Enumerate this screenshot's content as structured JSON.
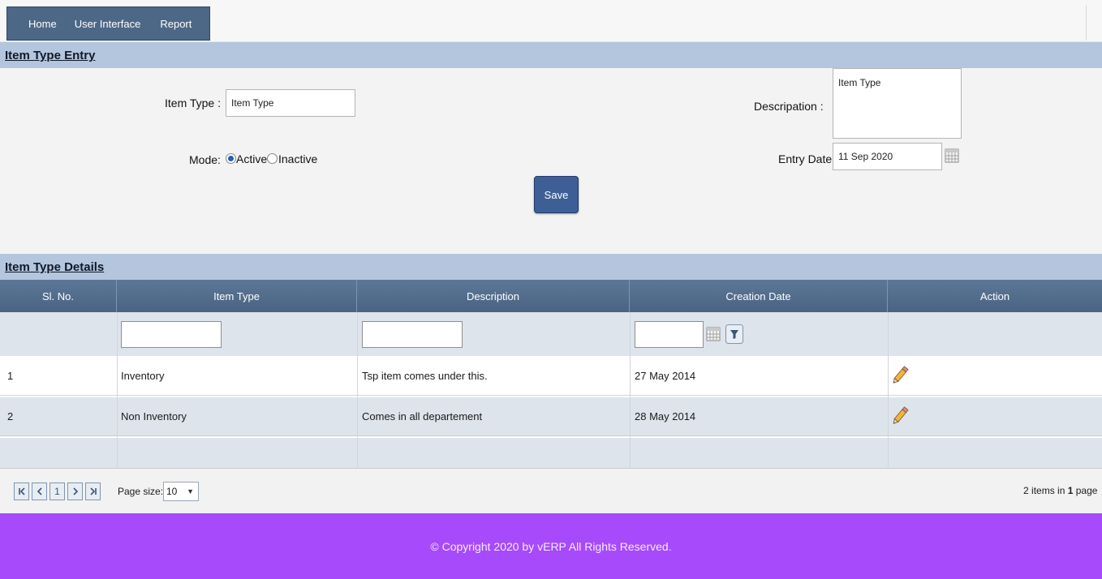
{
  "nav": {
    "items": [
      "Home",
      "User Interface",
      "Report"
    ]
  },
  "entry": {
    "title": "Item Type Entry",
    "item_type_label": "Item Type :",
    "item_type_value": "Item Type",
    "description_label": "Descripation :",
    "description_value": "Item Type",
    "mode_label": "Mode:",
    "mode_active": "Active",
    "mode_inactive": "Inactive",
    "mode_selected": "Active",
    "entry_date_label": "Entry Date",
    "entry_date_value": "11 Sep 2020",
    "save_label": "Save"
  },
  "details": {
    "title": "Item Type Details",
    "columns": [
      "Sl. No.",
      "Item Type",
      "Description",
      "Creation Date",
      "Action"
    ],
    "rows": [
      {
        "sl": "1",
        "item_type": "Inventory",
        "description": "Tsp item comes under this.",
        "creation_date": "27 May 2014",
        "action_icon": "edit-pencil-icon"
      },
      {
        "sl": "2",
        "item_type": "Non Inventory",
        "description": "Comes in all departement",
        "creation_date": "28 May 2014",
        "action_icon": "edit-pencil-icon"
      }
    ]
  },
  "pager": {
    "current_page": "1",
    "page_size_label": "Page size:",
    "page_size": "10",
    "items_info_count": "2",
    "items_info_mid": " items in ",
    "items_info_pages": "1",
    "items_info_tail": " page"
  },
  "footer": {
    "text": "© Copyright 2020 by vERP All Rights Reserved."
  },
  "colors": {
    "nav": "#4d6787",
    "section_header": "#b4c6de",
    "grid_header": "#4a6383",
    "save_button": "#3e5f96",
    "footer": "#a64afb"
  }
}
